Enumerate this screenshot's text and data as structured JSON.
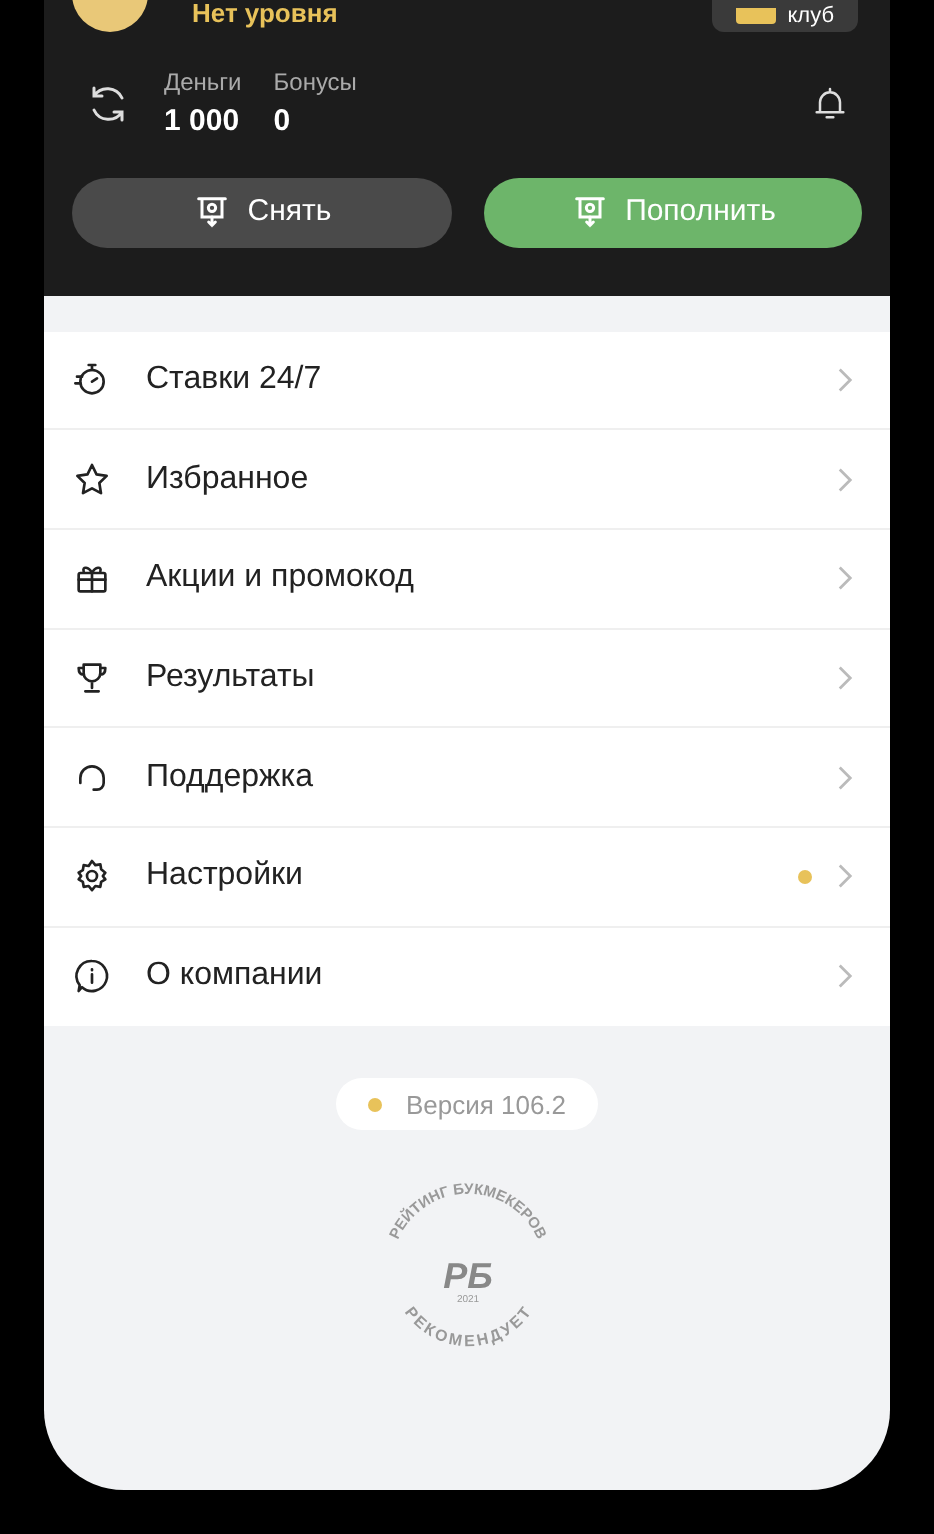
{
  "profile": {
    "level": "Нет уровня",
    "club_button": "клуб"
  },
  "balance": {
    "money_label": "Деньги",
    "money": "1 000",
    "bonus_label": "Бонусы",
    "bonus": "0"
  },
  "actions": [
    {
      "kind": "withdraw",
      "label": "Снять"
    },
    {
      "kind": "deposit",
      "label": "Пополнить"
    }
  ],
  "menu": [
    {
      "label": "Ставки 24/7",
      "dot": false
    },
    {
      "label": "Избранное",
      "dot": false
    },
    {
      "label": "Акции и промокод",
      "dot": false
    },
    {
      "label": "Результаты",
      "dot": false
    },
    {
      "label": "Поддержка",
      "dot": false
    },
    {
      "label": "Настройки",
      "dot": true
    },
    {
      "label": "О компании",
      "dot": false
    }
  ],
  "version": "Версия 106.2",
  "stamp": {
    "top": "РЕЙТИНГ БУКМЕКЕРОВ",
    "bottom": "РЕКОМЕНДУЕТ",
    "logo": "РБ",
    "year": "2021"
  }
}
